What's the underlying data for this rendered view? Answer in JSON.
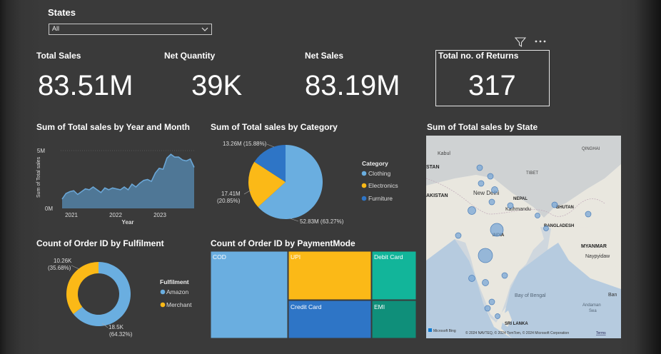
{
  "filter": {
    "title": "States",
    "selected": "All"
  },
  "kpis": [
    {
      "label": "Total Sales",
      "value": "83.51M"
    },
    {
      "label": "Net Quantity",
      "value": "39K"
    },
    {
      "label": "Net Sales",
      "value": "83.19M"
    },
    {
      "label": "Total no. of Returns",
      "value": "317"
    }
  ],
  "header_icons": [
    "filter-icon",
    "more-options-icon"
  ],
  "colors": {
    "area": "#4f7796",
    "area_line": "#6aa6d6",
    "clothing": "#6aaee0",
    "electronics": "#fbb917",
    "furniture": "#2e75c6",
    "amazon": "#6aaee0",
    "merchant": "#fbb917",
    "treemap": [
      "#6aaee0",
      "#fbb917",
      "#12b59a",
      "#2e75c6",
      "#0f8f7a"
    ]
  },
  "charts": {
    "sales_by_month": {
      "title": "Sum of Total sales by Year and Month",
      "ylabel": "Sum of Total sales",
      "xlabel": "Year",
      "yticks": [
        "5M",
        "0M"
      ],
      "xticks": [
        "2021",
        "2022",
        "2023"
      ]
    },
    "sales_by_category": {
      "title": "Sum of Total sales by Category",
      "legend_title": "Category",
      "labels": [
        "52.83M (63.27%)",
        "17.41M",
        "(20.85%)",
        "13.26M (15.88%)"
      ]
    },
    "sales_by_state": {
      "title": "Sum of Total sales by State",
      "labels": {
        "kabul": "Kabul",
        "qinghai": "QINGHAI",
        "tibet": "TIBET",
        "stan": "STAN",
        "pakistan": "AKISTAN",
        "new_delhi": "New Delhi",
        "nepal": "NEPAL",
        "kathmandu": "Kathmandu",
        "bhutan": "BHUTAN",
        "bangladesh": "BANGLADESH",
        "india": "INDIA",
        "myanmar": "MYANMAR",
        "naypyidaw": "Naypyidaw",
        "bay": "Bay of Bengal",
        "andaman": "Andaman",
        "andaman2": "Sea",
        "srilanka": "SRI LANKA",
        "ban": "Ban",
        "ms_bing": "Microsoft Bing",
        "copyright": "© 2024 NAVTEQ, © 2024 TomTom, © 2024 Microsoft Corporation",
        "terms": "Terms"
      }
    },
    "orders_by_fulfilment": {
      "title": "Count of Order ID by Fulfilment",
      "legend_title": "Fulfilment",
      "labels": [
        "10.26K",
        "(35.68%)",
        "18.5K",
        "(64.32%)"
      ]
    },
    "orders_by_paymentmode": {
      "title": "Count of Order ID by PaymentMode"
    }
  },
  "chart_data": [
    {
      "type": "area",
      "x": [
        "2020-12",
        "2021-01",
        "2021-02",
        "2021-03",
        "2021-04",
        "2021-05",
        "2021-06",
        "2021-07",
        "2021-08",
        "2021-09",
        "2021-10",
        "2021-11",
        "2021-12",
        "2022-01",
        "2022-02",
        "2022-03",
        "2022-04",
        "2022-05",
        "2022-06",
        "2022-07",
        "2022-08",
        "2022-09",
        "2022-10",
        "2022-11",
        "2022-12",
        "2023-01",
        "2023-02",
        "2023-03",
        "2023-04",
        "2023-05",
        "2023-06",
        "2023-07",
        "2023-08",
        "2023-09",
        "2023-10"
      ],
      "values": [
        1.0,
        1.6,
        1.8,
        1.9,
        1.5,
        1.8,
        2.1,
        2.0,
        2.3,
        2.0,
        1.7,
        2.2,
        2.0,
        2.2,
        2.1,
        2.0,
        2.3,
        2.0,
        2.6,
        2.3,
        2.7,
        3.0,
        3.1,
        2.9,
        3.8,
        4.3,
        4.2,
        5.4,
        5.8,
        5.5,
        5.5,
        5.2,
        5.1,
        5.3,
        4.4
      ],
      "ylim": [
        0,
        6.2
      ]
    },
    {
      "type": "pie",
      "categories": [
        "Clothing",
        "Electronics",
        "Furniture"
      ],
      "values": [
        52.83,
        17.41,
        13.26
      ],
      "percent": [
        63.27,
        20.85,
        15.88
      ]
    },
    {
      "type": "pie",
      "categories": [
        "Amazon",
        "Merchant"
      ],
      "values": [
        18.5,
        10.26
      ],
      "percent": [
        64.32,
        35.68
      ]
    },
    {
      "type": "treemap",
      "categories": [
        "COD",
        "UPI",
        "Debit Card",
        "Credit Card",
        "EMI"
      ]
    }
  ]
}
